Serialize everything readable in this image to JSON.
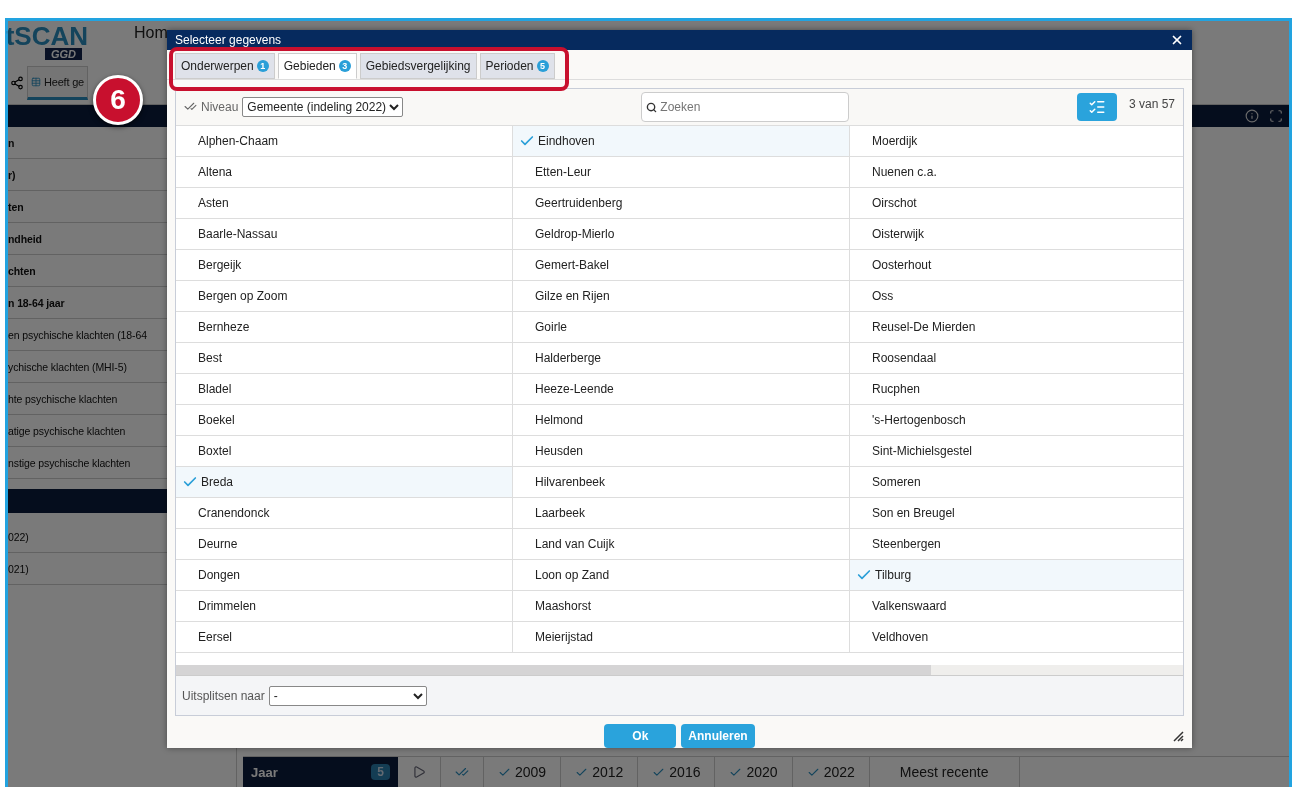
{
  "app": {
    "logo": "tSCAN",
    "logo_sub": "GGD",
    "nav": [
      "Hom"
    ],
    "toolbar_tab": "Heeft ge"
  },
  "sidebar": {
    "groups": [
      {
        "rows": [
          {
            "text": "n",
            "bold": true
          },
          {
            "text": "r)",
            "bold": true
          },
          {
            "text": "ten",
            "bold": true
          },
          {
            "text": "ndheid",
            "bold": true
          },
          {
            "text": "chten",
            "bold": true
          },
          {
            "text": "n 18-64 jaar",
            "bold": true
          },
          {
            "text": "en psychische klachten (18-64",
            "bold": false
          },
          {
            "text": "ychische klachten (MHI-5)",
            "bold": false
          },
          {
            "text": "hte psychische klachten",
            "bold": false
          },
          {
            "text": "atige psychische klachten",
            "bold": false
          },
          {
            "text": "nstige psychische klachten",
            "bold": false
          }
        ]
      },
      {
        "rows": [
          {
            "text": "022)",
            "bold": false
          },
          {
            "text": "021)",
            "bold": false
          }
        ]
      }
    ]
  },
  "period_bar": {
    "label": "Jaar",
    "count": "5",
    "years": [
      {
        "label": "2009",
        "checked": true
      },
      {
        "label": "2012",
        "checked": true
      },
      {
        "label": "2016",
        "checked": true
      },
      {
        "label": "2020",
        "checked": true
      },
      {
        "label": "2022",
        "checked": true
      }
    ],
    "recent": "Meest recente"
  },
  "dialog": {
    "title": "Selecteer gegevens",
    "tabs": [
      {
        "label": "Onderwerpen",
        "badge": "1",
        "selected": false
      },
      {
        "label": "Gebieden",
        "badge": "3",
        "selected": true
      },
      {
        "label": "Gebiedsvergelijking",
        "selected": false
      },
      {
        "label": "Perioden",
        "badge": "5",
        "selected": false
      }
    ],
    "level_label": "Niveau",
    "level_value": "Gemeente (indeling 2022)",
    "search": {
      "placeholder": "Zoeken"
    },
    "count": "3 van 57",
    "columns": [
      [
        {
          "name": "Alphen-Chaam",
          "checked": false
        },
        {
          "name": "Altena",
          "checked": false
        },
        {
          "name": "Asten",
          "checked": false
        },
        {
          "name": "Baarle-Nassau",
          "checked": false
        },
        {
          "name": "Bergeijk",
          "checked": false
        },
        {
          "name": "Bergen op Zoom",
          "checked": false
        },
        {
          "name": "Bernheze",
          "checked": false
        },
        {
          "name": "Best",
          "checked": false
        },
        {
          "name": "Bladel",
          "checked": false
        },
        {
          "name": "Boekel",
          "checked": false
        },
        {
          "name": "Boxtel",
          "checked": false
        },
        {
          "name": "Breda",
          "checked": true
        },
        {
          "name": "Cranendonck",
          "checked": false
        },
        {
          "name": "Deurne",
          "checked": false
        },
        {
          "name": "Dongen",
          "checked": false
        },
        {
          "name": "Drimmelen",
          "checked": false
        },
        {
          "name": "Eersel",
          "checked": false
        }
      ],
      [
        {
          "name": "Eindhoven",
          "checked": true
        },
        {
          "name": "Etten-Leur",
          "checked": false
        },
        {
          "name": "Geertruidenberg",
          "checked": false
        },
        {
          "name": "Geldrop-Mierlo",
          "checked": false
        },
        {
          "name": "Gemert-Bakel",
          "checked": false
        },
        {
          "name": "Gilze en Rijen",
          "checked": false
        },
        {
          "name": "Goirle",
          "checked": false
        },
        {
          "name": "Halderberge",
          "checked": false
        },
        {
          "name": "Heeze-Leende",
          "checked": false
        },
        {
          "name": "Helmond",
          "checked": false
        },
        {
          "name": "Heusden",
          "checked": false
        },
        {
          "name": "Hilvarenbeek",
          "checked": false
        },
        {
          "name": "Laarbeek",
          "checked": false
        },
        {
          "name": "Land van Cuijk",
          "checked": false
        },
        {
          "name": "Loon op Zand",
          "checked": false
        },
        {
          "name": "Maashorst",
          "checked": false
        },
        {
          "name": "Meierijstad",
          "checked": false
        }
      ],
      [
        {
          "name": "Moerdijk",
          "checked": false
        },
        {
          "name": "Nuenen c.a.",
          "checked": false
        },
        {
          "name": "Oirschot",
          "checked": false
        },
        {
          "name": "Oisterwijk",
          "checked": false
        },
        {
          "name": "Oosterhout",
          "checked": false
        },
        {
          "name": "Oss",
          "checked": false
        },
        {
          "name": "Reusel-De Mierden",
          "checked": false
        },
        {
          "name": "Roosendaal",
          "checked": false
        },
        {
          "name": "Rucphen",
          "checked": false
        },
        {
          "name": "'s-Hertogenbosch",
          "checked": false
        },
        {
          "name": "Sint-Michielsgestel",
          "checked": false
        },
        {
          "name": "Someren",
          "checked": false
        },
        {
          "name": "Son en Breugel",
          "checked": false
        },
        {
          "name": "Steenbergen",
          "checked": false
        },
        {
          "name": "Tilburg",
          "checked": true
        },
        {
          "name": "Valkenswaard",
          "checked": false
        },
        {
          "name": "Veldhoven",
          "checked": false
        }
      ]
    ],
    "split_label": "Uitsplitsen naar",
    "split_value": "-",
    "buttons": [
      "Ok",
      "Annuleren"
    ]
  },
  "annotation": {
    "step": "6"
  }
}
